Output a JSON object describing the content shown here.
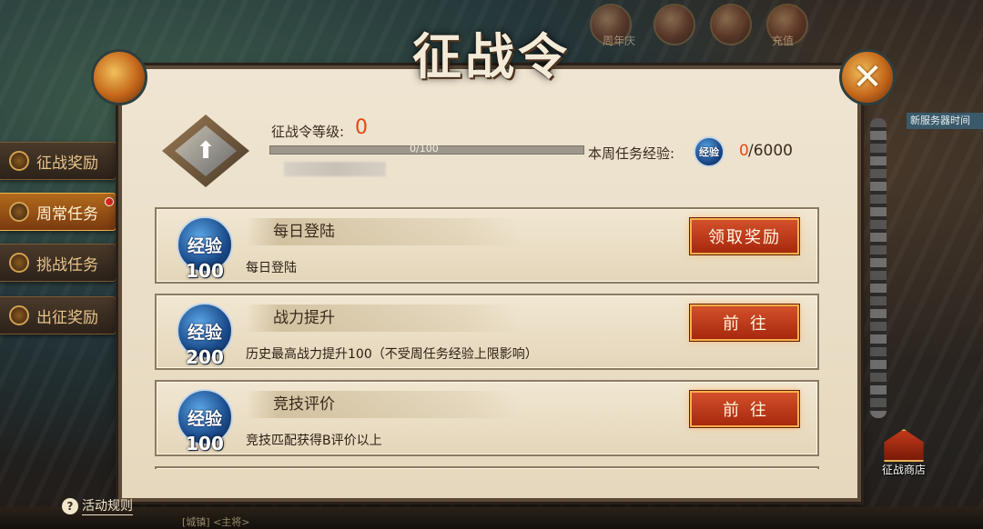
{
  "title": "征战令",
  "close_glyph": "✕",
  "top_icons": [
    "周年庆",
    "",
    "充值",
    ""
  ],
  "side_tabs": [
    {
      "label": "征战奖励",
      "active": false
    },
    {
      "label": "周常任务",
      "active": true,
      "has_dot": true
    },
    {
      "label": "挑战任务",
      "active": false
    },
    {
      "label": "出征奖励",
      "active": false
    }
  ],
  "header": {
    "level_label": "征战令等级:",
    "level_value": "0",
    "progress_text": "0/100",
    "progress_fraction": 0,
    "week_label": "本周任务经验:",
    "week_icon_text": "经验",
    "week_current": "0",
    "week_max": "/6000"
  },
  "tasks": [
    {
      "coin_text": "经验",
      "reward": "100",
      "name": "每日登陆",
      "desc": "每日登陆",
      "button": "领取奖励",
      "button_type": "claim"
    },
    {
      "coin_text": "经验",
      "reward": "200",
      "name": "战力提升",
      "desc": "历史最高战力提升100（不受周任务经验上限影响）",
      "button": "前往",
      "button_type": "go"
    },
    {
      "coin_text": "经验",
      "reward": "100",
      "name": "竞技评价",
      "desc": "竞技匹配获得B评价以上",
      "button": "前往",
      "button_type": "go"
    }
  ],
  "rules": {
    "icon": "?",
    "label": "活动规则"
  },
  "shop": {
    "label": "征战商店"
  },
  "right_strip_text": "新服务器时间",
  "chat_text": "[城镇] <主将>",
  "colors": {
    "accent": "#e24a12",
    "button": "#c23a1a",
    "panel": "#efe5d2"
  }
}
